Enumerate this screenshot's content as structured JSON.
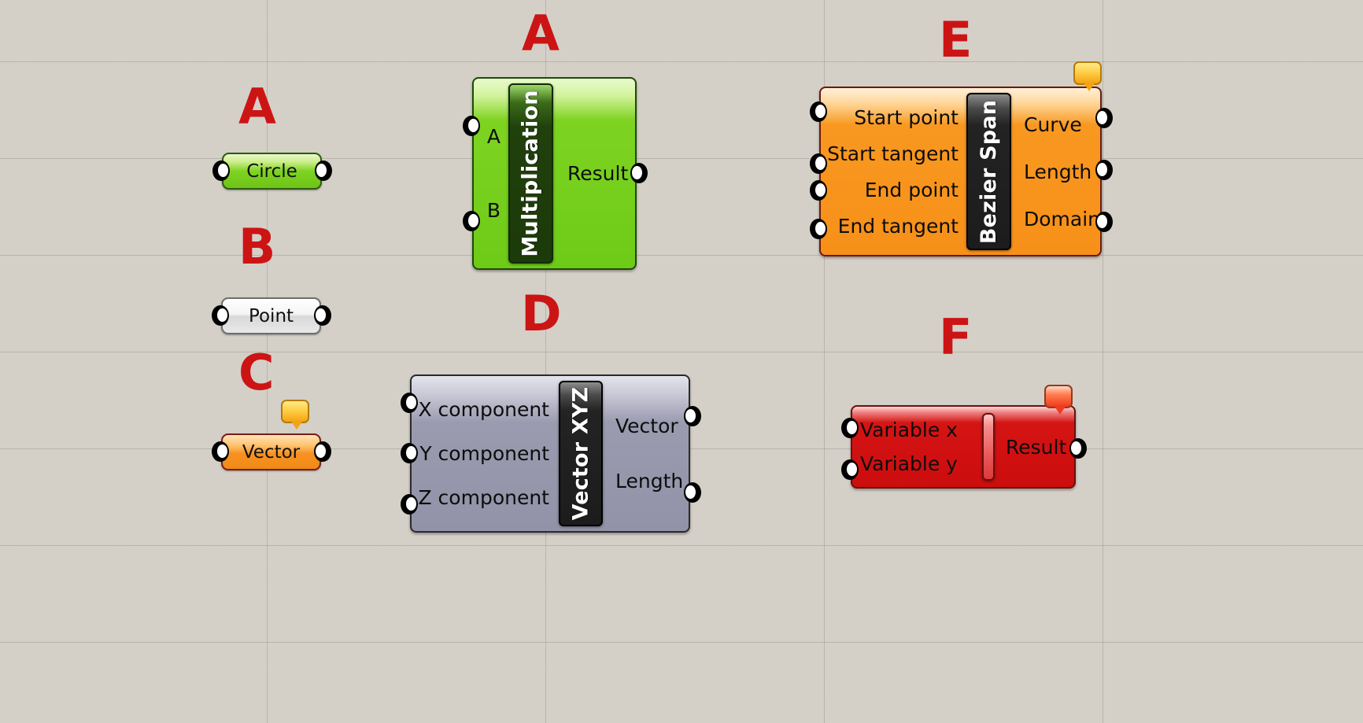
{
  "canvas": {
    "background_color": "#d4d0c8",
    "grid_line_color": "#78766e",
    "annotation_color": "#cc1414"
  },
  "annotations": [
    {
      "label": "A",
      "target": "circle-parameter"
    },
    {
      "label": "A",
      "target": "multiplication-component"
    },
    {
      "label": "B",
      "target": "point-parameter"
    },
    {
      "label": "C",
      "target": "vector-parameter"
    },
    {
      "label": "D",
      "target": "vector-xyz-component"
    },
    {
      "label": "E",
      "target": "bezier-span-component"
    },
    {
      "label": "F",
      "target": "expression-component"
    }
  ],
  "parameters": {
    "circle": {
      "label": "Circle",
      "color": "#7ed321",
      "has_input_port": true,
      "has_output_port": true
    },
    "point": {
      "label": "Point",
      "color": "#e9e9e9",
      "has_input_port": true,
      "has_output_port": true
    },
    "vector": {
      "label": "Vector",
      "color": "#f79121",
      "has_input_port": true,
      "has_output_port": true,
      "balloon": "warning"
    }
  },
  "components": {
    "multiplication": {
      "title": "Multiplication",
      "color": "#7ed321",
      "inputs": [
        "A",
        "B"
      ],
      "outputs": [
        "Result"
      ]
    },
    "bezier_span": {
      "title": "Bezier Span",
      "color": "#f89820",
      "inputs": [
        "Start point",
        "Start tangent",
        "End point",
        "End tangent"
      ],
      "outputs": [
        "Curve",
        "Length",
        "Domain"
      ],
      "balloon": "warning"
    },
    "vector_xyz": {
      "title": "Vector XYZ",
      "color": "#9292a8",
      "inputs": [
        "X component",
        "Y component",
        "Z component"
      ],
      "outputs": [
        "Vector",
        "Length"
      ]
    },
    "expression": {
      "title": "",
      "color": "#cc0d0d",
      "inputs": [
        "Variable x",
        "Variable y"
      ],
      "outputs": [
        "Result"
      ],
      "balloon": "error"
    }
  },
  "balloons": {
    "warning": {
      "kind": "warning-balloon-icon",
      "color": "#f5a312"
    },
    "error": {
      "kind": "error-balloon-icon",
      "color": "#f03a1c"
    }
  }
}
